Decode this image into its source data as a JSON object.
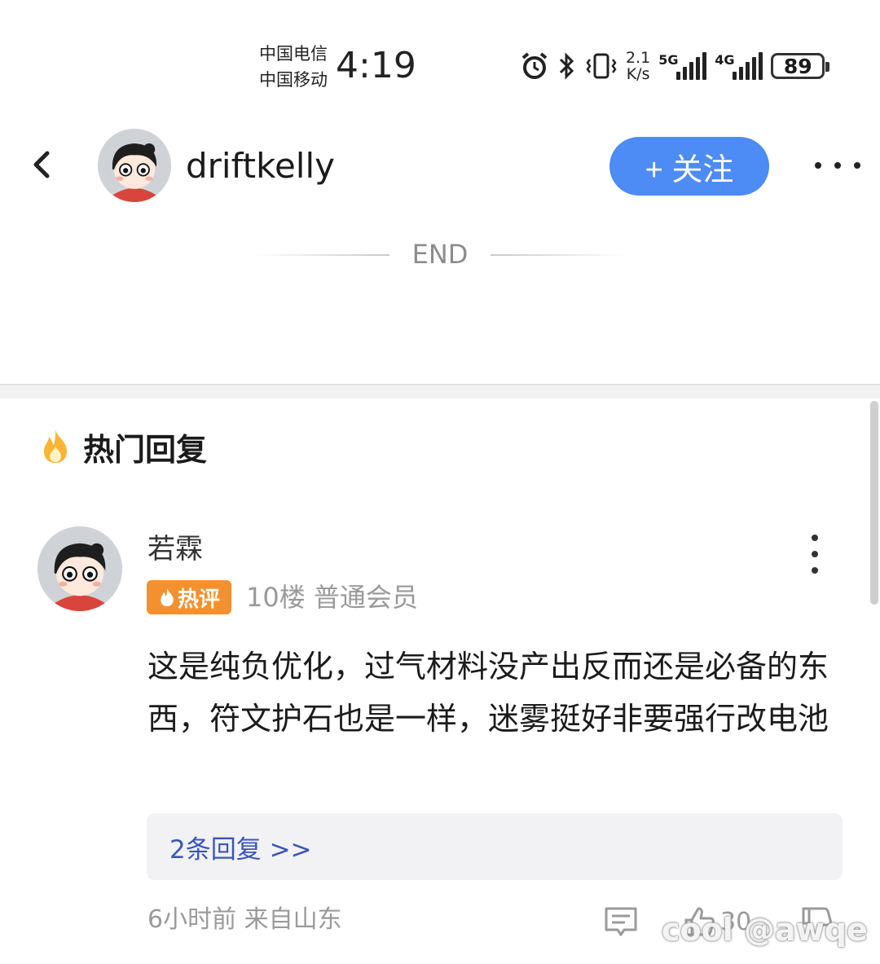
{
  "status_bar": {
    "carrier_1": "中国电信",
    "carrier_2": "中国移动",
    "time": "4:19",
    "net_speed_value": "2.1",
    "net_speed_unit": "K/s",
    "signal_1_label": "5G",
    "signal_2_label": "4G",
    "battery": "89"
  },
  "header": {
    "username": "driftkelly",
    "follow_label": "+ 关注"
  },
  "divider": {
    "label": "END"
  },
  "hot_replies": {
    "title": "热门回复",
    "comment": {
      "author": "若霖",
      "badge": "热评",
      "meta": "10楼 普通会员",
      "text": "这是纯负优化，过气材料没产出反而还是必备的东西，符文护石也是一样，迷雾挺好非要强行改电池",
      "replies_link": "2条回复 >>",
      "time_location": "6小时前 来自山东",
      "like_count": "30"
    }
  },
  "watermark": "@awqe",
  "colors": {
    "accent_blue": "#4d8bf5",
    "badge_orange": "#f5902f",
    "link_blue": "#3a56b8"
  }
}
